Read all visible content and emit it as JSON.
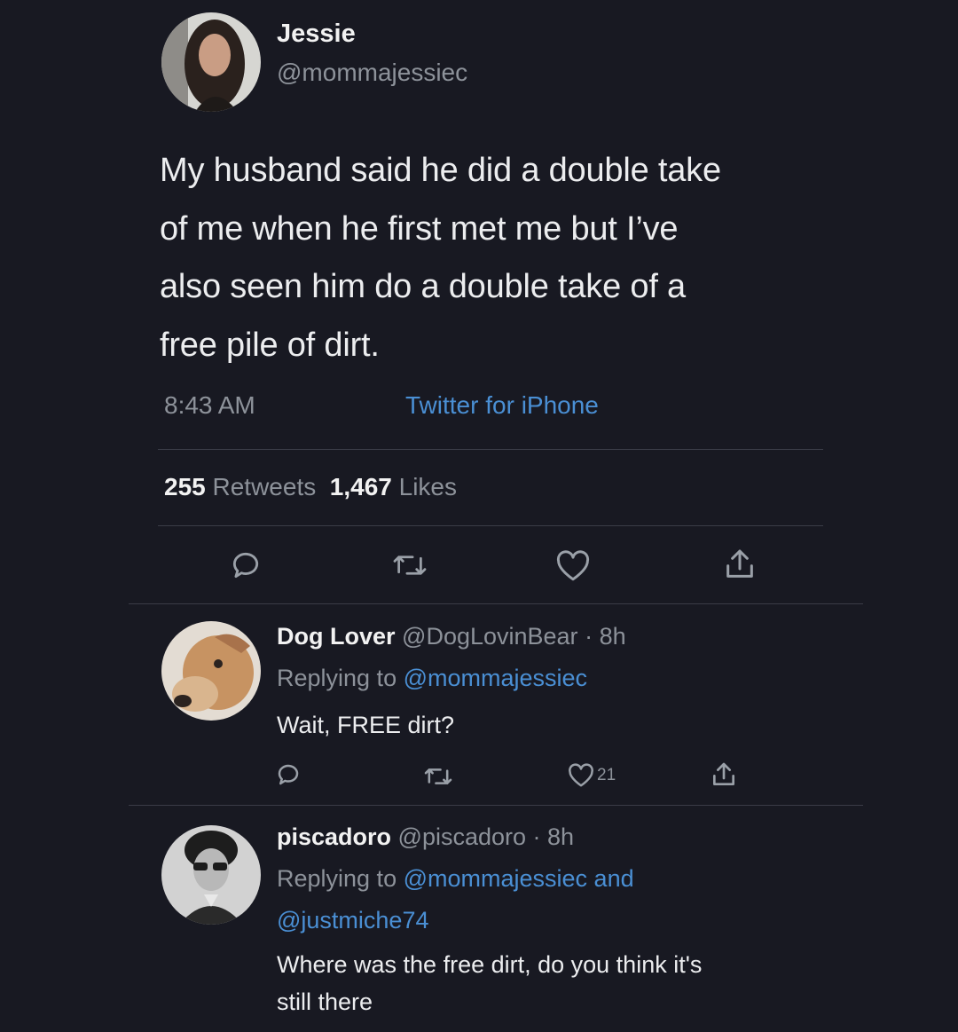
{
  "tweet": {
    "author_name": "Jessie",
    "author_handle": "@mommajessiec",
    "text_lines": [
      "My husband said he did a double take",
      "of me when he first met me but I’ve",
      "also seen him do a double take of a",
      "free pile of dirt."
    ],
    "time": "8:43 AM",
    "source": "Twitter for iPhone",
    "retweet_count": "255",
    "retweet_label": "Retweets",
    "like_count": "1,467",
    "like_label": "Likes",
    "actions": [
      "reply-icon",
      "retweet-icon",
      "like-icon",
      "share-icon"
    ]
  },
  "replies": [
    {
      "name": "Dog Lover",
      "handle": "@DogLovinBear",
      "age": "· 8h",
      "replying_prefix": "Replying to",
      "replying_to": "@mommajessiec",
      "text": "Wait, FREE dirt?",
      "like_count": "21"
    },
    {
      "name": "piscadoro",
      "handle": "@piscadoro",
      "age": "· 8h",
      "replying_prefix": "Replying to",
      "replying_to": "@mommajessiec and",
      "replying_to_2": "@justmiche74",
      "text_lines": [
        "Where was the free dirt, do you think it's",
        "still there"
      ]
    }
  ],
  "colors": {
    "background": "#181922",
    "link": "#4a8fd4",
    "muted": "#8d929a"
  }
}
